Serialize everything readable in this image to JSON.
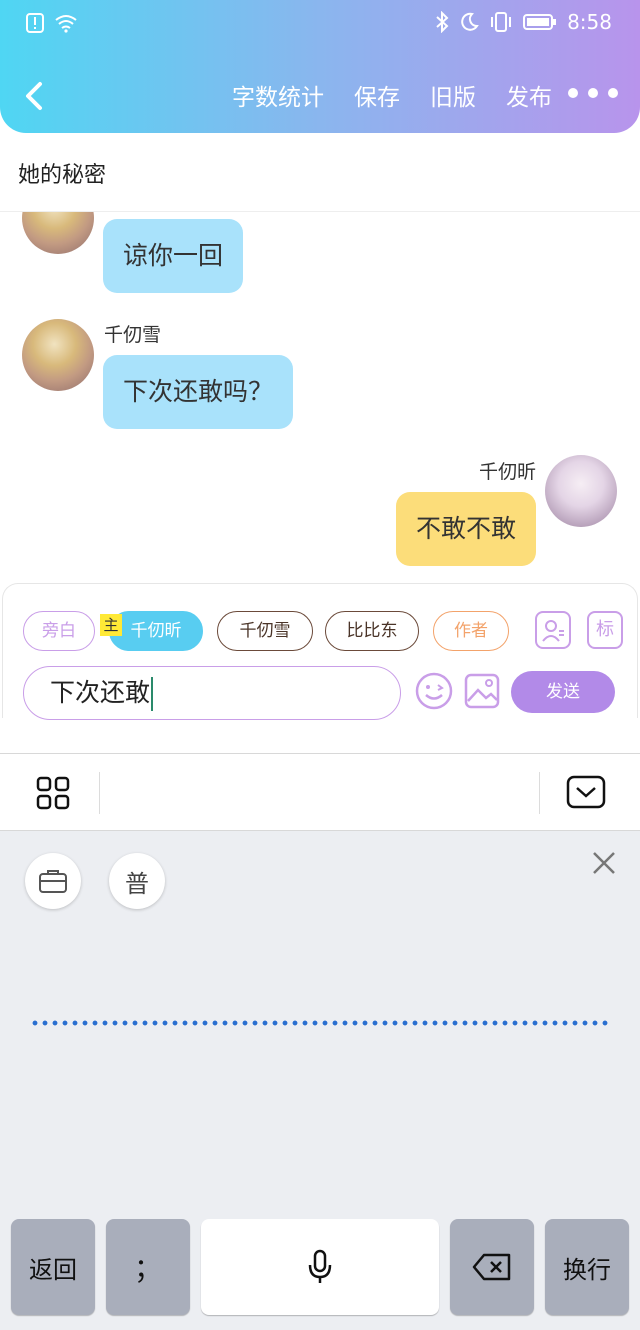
{
  "status_bar": {
    "time": "8:58"
  },
  "nav": {
    "actions": [
      "字数统计",
      "保存",
      "旧版",
      "发布"
    ]
  },
  "page_title": "她的秘密",
  "messages": [
    {
      "side": "left",
      "name": "",
      "text": "谅你一回",
      "avatar": "gold-haired-character-avatar"
    },
    {
      "side": "left",
      "name": "千仞雪",
      "text": "下次还敢吗？",
      "avatar": "gold-haired-character-avatar"
    },
    {
      "side": "right",
      "name": "千仞昕",
      "text": "不敢不敢",
      "avatar": "pink-haired-character-avatar"
    }
  ],
  "roles": {
    "narration": "旁白",
    "main_tag": "主",
    "active": "千仞昕",
    "others": [
      "千仞雪",
      "比比东"
    ],
    "author": "作者",
    "tag_icon": "标"
  },
  "composer": {
    "input_value": "下次还敢",
    "send_label": "发送"
  },
  "keyboard": {
    "mode_label": "普",
    "keys": {
      "back": "返回",
      "semicolon": "；",
      "newline": "换行"
    }
  },
  "colors": {
    "header_gradient": [
      "#4fd6f3",
      "#b894ec"
    ],
    "bubble_left": "#a9e2fb",
    "bubble_right": "#fcdd7a",
    "accent_purple": "#b28ae8",
    "active_role": "#58cdf1"
  }
}
